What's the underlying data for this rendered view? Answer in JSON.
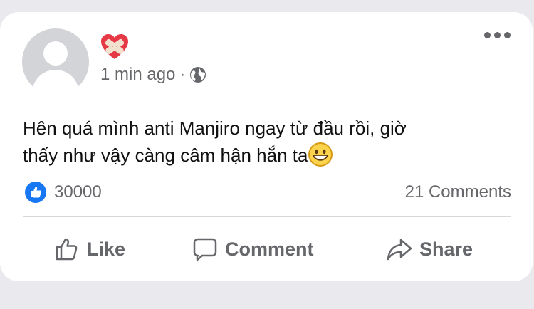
{
  "post": {
    "author_emoji": "heart-bandaged-emoji",
    "time": "1 min ago",
    "separator": "·",
    "audience_icon": "globe-icon",
    "text_line1": "Hên quá mình anti Manjiro ngay từ đầu rồi, giờ",
    "text_line2": "thấy như vậy càng câm hận hắn ta",
    "trailing_emoji": "smiling-face-emoji"
  },
  "stats": {
    "like_count": "30000",
    "comments": "21 Comments"
  },
  "actions": {
    "like_label": "Like",
    "comment_label": "Comment",
    "share_label": "Share"
  },
  "colors": {
    "like_blue": "#1877f2",
    "secondary_text": "#65676b",
    "divider": "#d6d8dc"
  }
}
